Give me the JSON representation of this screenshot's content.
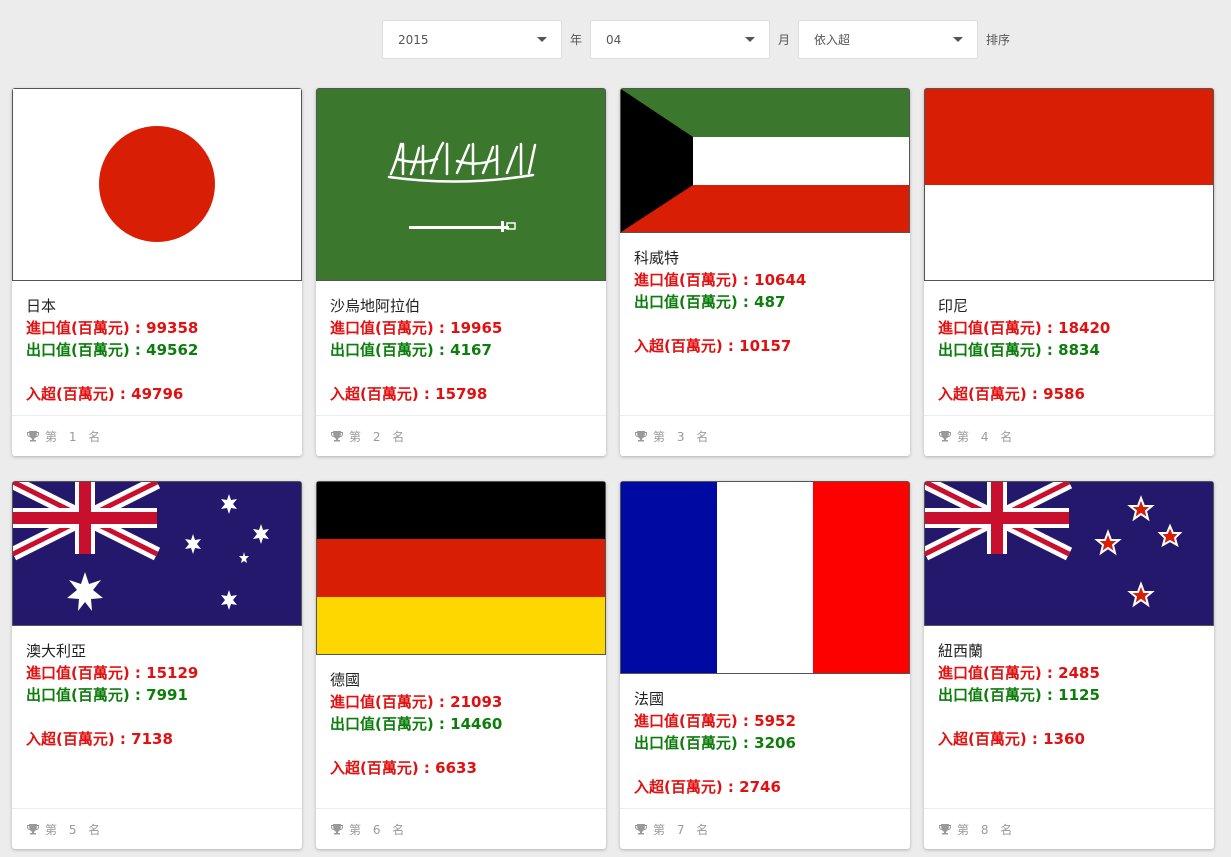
{
  "filters": {
    "year": "2015",
    "year_label": "年",
    "month": "04",
    "month_label": "月",
    "sort": "依入超",
    "sort_label": "排序"
  },
  "labels": {
    "import": "進口值(百萬元) : ",
    "export": "出口值(百萬元) : ",
    "balance": "入超(百萬元) : "
  },
  "cards": [
    {
      "country": "日本",
      "import": "99358",
      "export": "49562",
      "balance": "49796",
      "rank": "第 1 名"
    },
    {
      "country": "沙烏地阿拉伯",
      "import": "19965",
      "export": "4167",
      "balance": "15798",
      "rank": "第 2 名"
    },
    {
      "country": "科威特",
      "import": "10644",
      "export": "487",
      "balance": "10157",
      "rank": "第 3 名"
    },
    {
      "country": "印尼",
      "import": "18420",
      "export": "8834",
      "balance": "9586",
      "rank": "第 4 名"
    },
    {
      "country": "澳大利亞",
      "import": "15129",
      "export": "7991",
      "balance": "7138",
      "rank": "第 5 名"
    },
    {
      "country": "德國",
      "import": "21093",
      "export": "14460",
      "balance": "6633",
      "rank": "第 6 名"
    },
    {
      "country": "法國",
      "import": "5952",
      "export": "3206",
      "balance": "2746",
      "rank": "第 7 名"
    },
    {
      "country": "紐西蘭",
      "import": "2485",
      "export": "1125",
      "balance": "1360",
      "rank": "第 8 名"
    }
  ],
  "colors": {
    "import": "#e21111",
    "export": "#0d7d0d",
    "balance": "#e21111"
  }
}
